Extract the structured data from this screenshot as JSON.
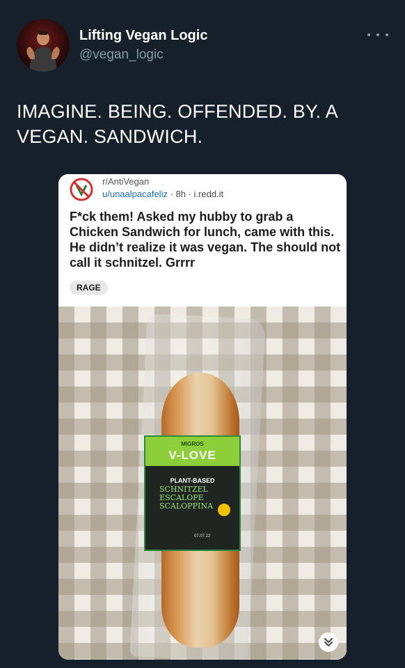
{
  "tweet": {
    "author": {
      "name": "Lifting Vegan Logic",
      "handle": "@vegan_logic"
    },
    "text": "IMAGINE. BEING. OFFENDED. BY. A VEGAN. SANDWICH."
  },
  "embedded_post": {
    "subreddit": "r/AntiVegan",
    "user": "u/unaalpacafeliz",
    "meta": " · 8h · i.redd.it",
    "title": "F*ck them! Asked my hubby to grab a Chicken Sandwich for lunch, came with this. He didn’t realize it was vegan. The should not call it schnitzel. Grrrr",
    "flair": "RAGE",
    "photo": {
      "label_brand": "MIGROS",
      "label_logo": "V-LOVE",
      "label_subtitle": "PLANT-BASED",
      "label_product": "SCHNITZEL ESCALOPE SCALOPPINA",
      "label_date": "07.07.22"
    }
  },
  "icons": {
    "more": "more-options-icon",
    "subreddit": "antivegan-subreddit-icon",
    "expand": "chevron-double-down-icon"
  },
  "colors": {
    "background": "#15202b",
    "text_primary": "#ffffff",
    "text_secondary": "#8b98a5",
    "link": "#1a6fb5",
    "label_green": "#8ccf3b"
  }
}
